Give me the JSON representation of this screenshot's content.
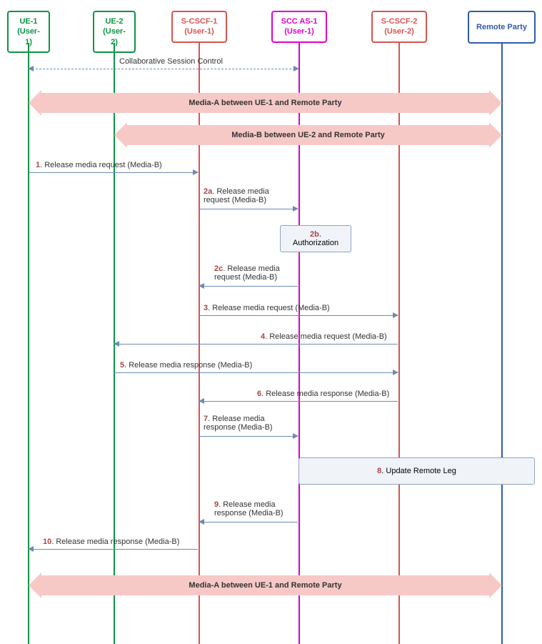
{
  "participants": [
    {
      "id": "ue1",
      "line1": "UE-1",
      "line2": "(User-1)"
    },
    {
      "id": "ue2",
      "line1": "UE-2",
      "line2": "(User-2)"
    },
    {
      "id": "scscf1",
      "line1": "S-CSCF-1",
      "line2": "(User-1)"
    },
    {
      "id": "sccas1",
      "line1": "SCC AS-1",
      "line2": "(User-1)"
    },
    {
      "id": "scscf2",
      "line1": "S-CSCF-2",
      "line2": "(User-2)"
    },
    {
      "id": "remote",
      "line1": "Remote Party"
    }
  ],
  "collab_label": "Collaborative Session Control",
  "media_a": "Media-A between UE-1 and Remote Party",
  "media_b": "Media-B between UE-2 and Remote Party",
  "steps": {
    "s1": {
      "num": "1",
      "text": ". Release media request (Media-B)"
    },
    "s2a": {
      "num": "2a",
      "text": ". Release media",
      "text2": "request (Media-B)"
    },
    "s2b": {
      "num": "2b",
      "text": ".",
      "text2": "Authorization"
    },
    "s2c": {
      "num": "2c",
      "text": ". Release media",
      "text2": "request (Media-B)"
    },
    "s3": {
      "num": "3",
      "text": ". Release media request (Media-B)"
    },
    "s4": {
      "num": "4",
      "text": ". Release media request (Media-B)"
    },
    "s5": {
      "num": "5",
      "text": ". Release media response (Media-B)"
    },
    "s6": {
      "num": "6",
      "text": ". Release media response (Media-B)"
    },
    "s7": {
      "num": "7",
      "text": ". Release media",
      "text2": "response (Media-B)"
    },
    "s8": {
      "num": "8",
      "text": ". Update Remote Leg"
    },
    "s9": {
      "num": "9",
      "text": ". Release media",
      "text2": "response (Media-B)"
    },
    "s10": {
      "num": "10",
      "text": ". Release media response (Media-B)"
    }
  },
  "chart_data": {
    "type": "sequence-diagram",
    "participants": [
      "UE-1 (User-1)",
      "UE-2 (User-2)",
      "S-CSCF-1 (User-1)",
      "SCC AS-1 (User-1)",
      "S-CSCF-2 (User-2)",
      "Remote Party"
    ],
    "collab_control": {
      "type": "bidirectional-dashed",
      "between": [
        "UE-1",
        "SCC AS-1"
      ],
      "label": "Collaborative Session Control"
    },
    "media_flows": [
      {
        "label": "Media-A between UE-1 and Remote Party",
        "between": [
          "UE-1",
          "Remote Party"
        ],
        "position": "before-steps"
      },
      {
        "label": "Media-B between UE-2 and Remote Party",
        "between": [
          "UE-2",
          "Remote Party"
        ],
        "position": "before-steps"
      },
      {
        "label": "Media-A between UE-1 and Remote Party",
        "between": [
          "UE-1",
          "Remote Party"
        ],
        "position": "after-steps"
      }
    ],
    "messages": [
      {
        "step": "1",
        "from": "UE-1",
        "to": "S-CSCF-1",
        "label": "Release media request (Media-B)"
      },
      {
        "step": "2a",
        "from": "S-CSCF-1",
        "to": "SCC AS-1",
        "label": "Release media request (Media-B)"
      },
      {
        "step": "2b",
        "at": "SCC AS-1",
        "type": "process-box",
        "label": "Authorization"
      },
      {
        "step": "2c",
        "from": "SCC AS-1",
        "to": "S-CSCF-1",
        "label": "Release media request (Media-B)"
      },
      {
        "step": "3",
        "from": "S-CSCF-1",
        "to": "S-CSCF-2",
        "label": "Release media request (Media-B)"
      },
      {
        "step": "4",
        "from": "S-CSCF-2",
        "to": "UE-2",
        "label": "Release media request (Media-B)"
      },
      {
        "step": "5",
        "from": "UE-2",
        "to": "S-CSCF-2",
        "label": "Release media response (Media-B)"
      },
      {
        "step": "6",
        "from": "S-CSCF-2",
        "to": "S-CSCF-1",
        "label": "Release media response (Media-B)"
      },
      {
        "step": "7",
        "from": "S-CSCF-1",
        "to": "SCC AS-1",
        "label": "Release media response (Media-B)"
      },
      {
        "step": "8",
        "between": [
          "SCC AS-1",
          "Remote Party"
        ],
        "type": "process-box",
        "label": "Update Remote Leg"
      },
      {
        "step": "9",
        "from": "SCC AS-1",
        "to": "S-CSCF-1",
        "label": "Release media response (Media-B)"
      },
      {
        "step": "10",
        "from": "S-CSCF-1",
        "to": "UE-1",
        "label": "Release media response (Media-B)"
      }
    ]
  }
}
